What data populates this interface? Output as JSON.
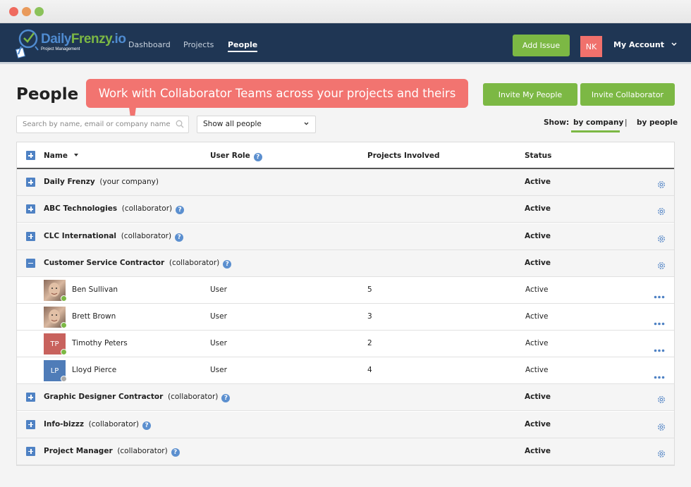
{
  "window": {
    "controls": [
      {
        "name": "close",
        "color": "#ef6a5e"
      },
      {
        "name": "minimize",
        "color": "#e99a5b"
      },
      {
        "name": "maximize",
        "color": "#8bc25a"
      }
    ]
  },
  "header": {
    "logo": {
      "part1": "Daily",
      "part2": "Frenzy",
      "part3": ".io",
      "tagline": "Project Management"
    },
    "nav": [
      {
        "label": "Dashboard",
        "active": false
      },
      {
        "label": "Projects",
        "active": false
      },
      {
        "label": "People",
        "active": true
      }
    ],
    "add_issue_label": "Add Issue",
    "user_initials": "NK",
    "account_label": "My Account"
  },
  "page": {
    "title": "People",
    "callout": "Work with Collaborator Teams across your projects and theirs",
    "invite_my_people_label": "Invite My People",
    "invite_collaborator_label": "Invite Collaborator",
    "search": {
      "placeholder": "Search by name, email or company name",
      "value": ""
    },
    "filter": {
      "selected": "Show all people"
    },
    "show": {
      "label": "Show:",
      "options": [
        "by company",
        "by people"
      ],
      "separator": "|",
      "active": "by company"
    }
  },
  "table": {
    "columns": [
      "Name",
      "User Role",
      "Projects Involved",
      "Status"
    ],
    "groups": [
      {
        "name": "Daily Frenzy",
        "type": "(your company)",
        "status": "Active",
        "expanded": false,
        "help": false
      },
      {
        "name": "ABC Technologies",
        "type": "(collaborator)",
        "status": "Active",
        "expanded": false,
        "help": true
      },
      {
        "name": "CLC International",
        "type": "(collaborator)",
        "status": "Active",
        "expanded": false,
        "help": true
      },
      {
        "name": "Customer Service Contractor",
        "type": "(collaborator)",
        "status": "Active",
        "expanded": true,
        "help": true,
        "members": [
          {
            "name": "Ben Sullivan",
            "role": "User",
            "projects": "5",
            "status": "Active",
            "online": true,
            "avatar": "photo"
          },
          {
            "name": "Brett Brown",
            "role": "User",
            "projects": "3",
            "status": "Active",
            "online": true,
            "avatar": "photo"
          },
          {
            "name": "Timothy Peters",
            "role": "User",
            "projects": "2",
            "status": "Active",
            "online": true,
            "initials": "TP",
            "avatar_color": "#c8625d"
          },
          {
            "name": "Lloyd Pierce",
            "role": "User",
            "projects": "4",
            "status": "Active",
            "online": false,
            "initials": "LP",
            "avatar_color": "#4f7cb8"
          }
        ]
      },
      {
        "name": "Graphic Designer Contractor",
        "type": "(collaborator)",
        "status": "Active",
        "expanded": false,
        "help": true
      },
      {
        "name": "Info-bizzz",
        "type": "(collaborator)",
        "status": "Active",
        "expanded": false,
        "help": true
      },
      {
        "name": "Project Manager",
        "type": "(collaborator)",
        "status": "Active",
        "expanded": false,
        "help": true
      }
    ]
  },
  "colors": {
    "nav_bg": "#1f3654",
    "accent_green": "#7cb844",
    "callout": "#f27470",
    "icon_blue": "#4f82c4",
    "online": "#7cb844",
    "offline": "#aaaaaa"
  }
}
